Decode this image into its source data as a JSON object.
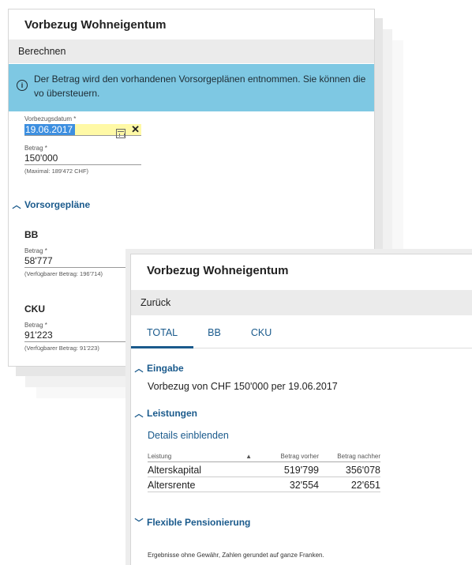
{
  "back_panel": {
    "title": "Vorbezug Wohneigentum",
    "toolbar_button": "Berechnen",
    "info_text": "Der Betrag wird den vorhandenen Vorsorgeplänen entnommen. Sie können die vo übersteuern.",
    "vorbezugsdatum_label": "Vorbezugsdatum *",
    "vorbezugsdatum_value": "19.06.2017",
    "betrag_label": "Betrag *",
    "betrag_value": "150'000",
    "betrag_hint": "(Maximal: 189'472 CHF)",
    "vorsorgeplaene_label": "Vorsorgepläne",
    "plans": [
      {
        "name": "BB",
        "label": "Betrag *",
        "value": "58'777",
        "hint": "(Verfügbarer Betrag: 196'714)"
      },
      {
        "name": "CKU",
        "label": "Betrag *",
        "value": "91'223",
        "hint": "(Verfügbarer Betrag: 91'223)"
      }
    ]
  },
  "front_panel": {
    "title": "Vorbezug Wohneigentum",
    "toolbar_button": "Zurück",
    "tabs": [
      "TOTAL",
      "BB",
      "CKU"
    ],
    "eingabe_label": "Eingabe",
    "eingabe_text": "Vorbezug von CHF 150'000 per 19.06.2017",
    "leistungen_label": "Leistungen",
    "details_link": "Details einblenden",
    "table": {
      "headers": [
        "Leistung",
        "Betrag vorher",
        "Betrag nachher"
      ],
      "sort_indicator": "▲",
      "rows": [
        [
          "Alterskapital",
          "519'799",
          "356'078"
        ],
        [
          "Altersrente",
          "32'554",
          "22'651"
        ]
      ]
    },
    "flexible_label": "Flexible Pensionierung",
    "footer": "Ergebnisse ohne Gewähr, Zahlen gerundet auf ganze Franken."
  },
  "colors": {
    "accent": "#1a5a8c",
    "info_bg": "#7ec8e3",
    "toolbar_bg": "#ebebeb",
    "date_highlight": "#fff9a6"
  }
}
